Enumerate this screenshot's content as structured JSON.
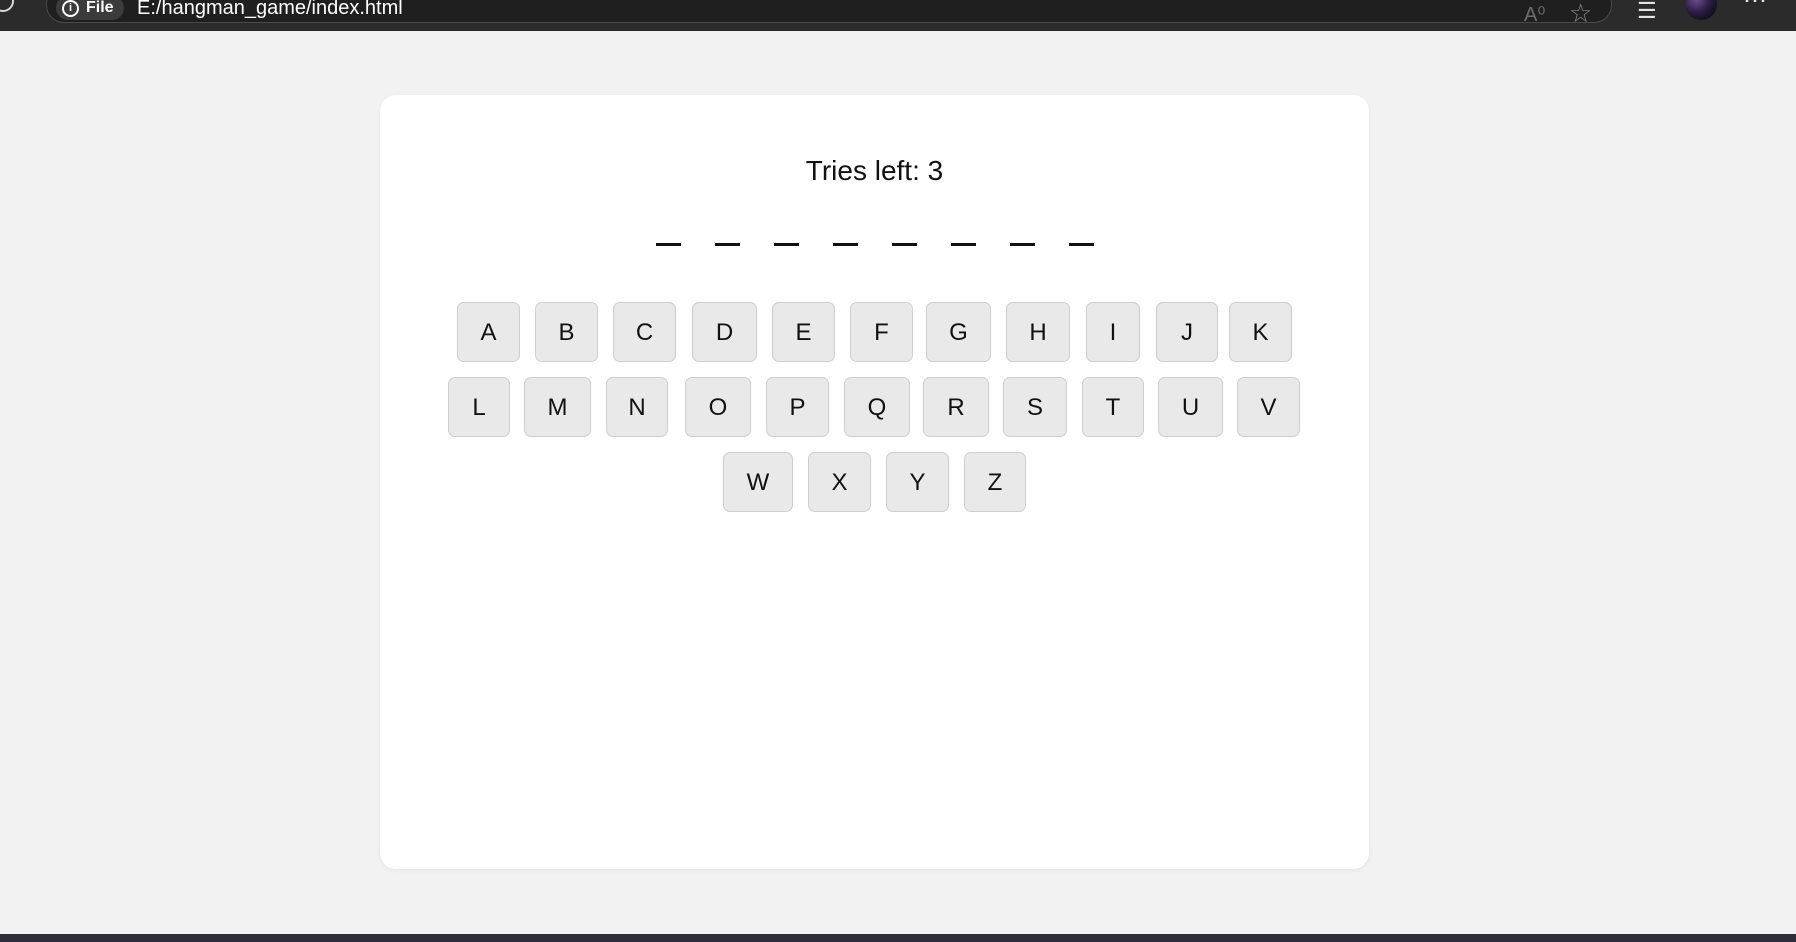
{
  "browser": {
    "site_info_label": "File",
    "url": "E:/hangman_game/index.html",
    "read_aloud_glyph": "A⁰"
  },
  "game": {
    "tries_text": "Tries left: 3",
    "word_slots": [
      "",
      "",
      "",
      "",
      "",
      "",
      "",
      ""
    ]
  },
  "keyboard": {
    "keys": [
      "A",
      "B",
      "C",
      "D",
      "E",
      "F",
      "G",
      "H",
      "I",
      "J",
      "K",
      "L",
      "M",
      "N",
      "O",
      "P",
      "Q",
      "R",
      "S",
      "T",
      "U",
      "V",
      "W",
      "X",
      "Y",
      "Z"
    ]
  },
  "colors": {
    "page_background": "#f2f2f2",
    "card_background": "#ffffff",
    "key_background": "#e9e9e9",
    "key_border": "#cfcfcf",
    "browser_bar": "#2b2b2b"
  },
  "icons": {
    "reload": "reload-icon",
    "info": "info-icon",
    "read_aloud": "read-aloud-icon",
    "favorite": "star-icon",
    "collections": "collections-icon",
    "profile": "avatar",
    "more": "more-icon"
  }
}
